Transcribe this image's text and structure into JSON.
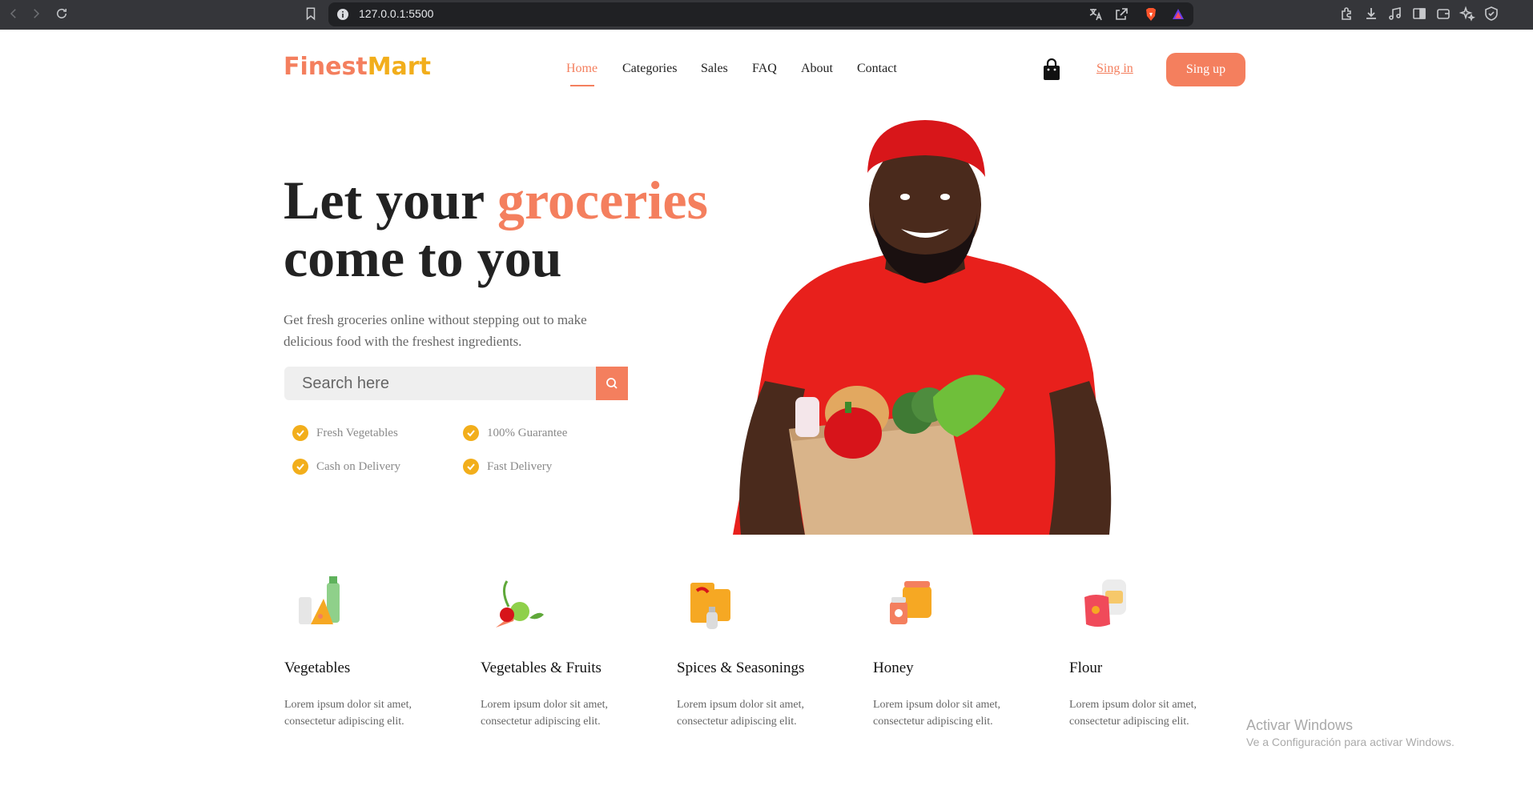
{
  "browser": {
    "url": "127.0.0.1:5500"
  },
  "header": {
    "logo_part1": "Finest",
    "logo_part2": "Mart",
    "nav": [
      "Home",
      "Categories",
      "Sales",
      "FAQ",
      "About",
      "Contact"
    ],
    "active_nav": "Home",
    "signin_label": "Sing in",
    "signup_label": "Sing up"
  },
  "hero": {
    "title_part1": "Let your ",
    "title_accent": "groceries",
    "title_part2": "come to you",
    "lead": "Get fresh groceries online without stepping out to make delicious food with the freshest ingredients.",
    "search_placeholder": "Search here",
    "features": [
      "Fresh Vegetables",
      "100% Guarantee",
      "Cash on Delivery",
      "Fast Delivery"
    ]
  },
  "categories": [
    {
      "title": "Vegetables",
      "desc": "Lorem ipsum dolor sit amet, consectetur adipiscing elit."
    },
    {
      "title": "Vegetables & Fruits",
      "desc": "Lorem ipsum dolor sit amet, consectetur adipiscing elit."
    },
    {
      "title": "Spices & Seasonings",
      "desc": "Lorem ipsum dolor sit amet, consectetur adipiscing elit."
    },
    {
      "title": "Honey",
      "desc": "Lorem ipsum dolor sit amet, consectetur adipiscing elit."
    },
    {
      "title": "Flour",
      "desc": "Lorem ipsum dolor sit amet, consectetur adipiscing elit."
    }
  ],
  "watermark": {
    "line1": "Activar Windows",
    "line2": "Ve a Configuración para activar Windows."
  },
  "colors": {
    "accent": "#f47f5e",
    "brand_yellow": "#f2ae1b",
    "chrome": "#35363a"
  }
}
